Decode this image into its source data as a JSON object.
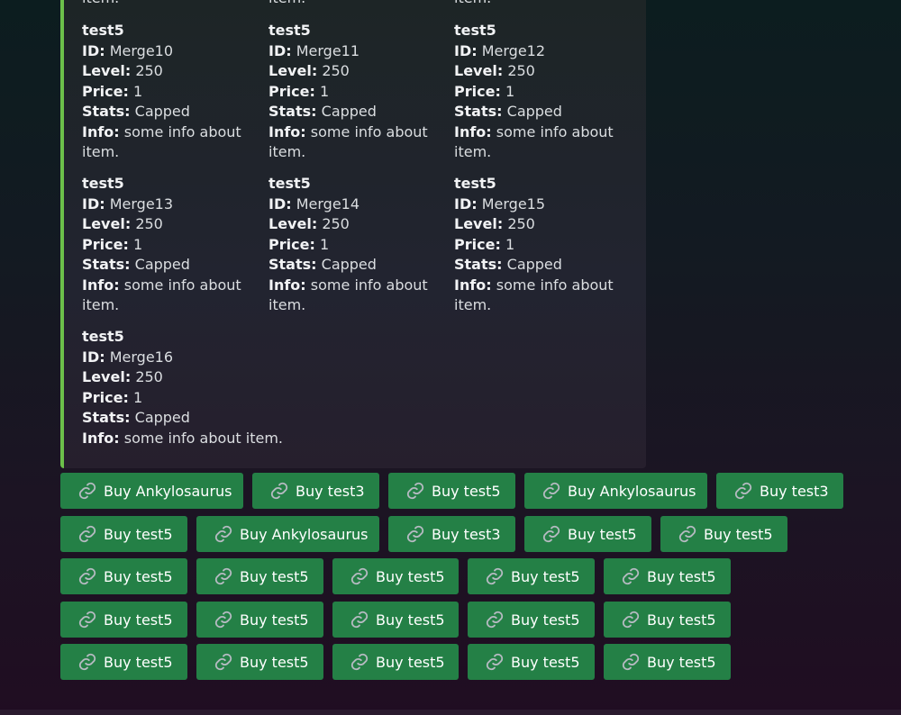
{
  "embed": {
    "accent_color": "#6cc04a",
    "top_partial": [
      "item.",
      "item.",
      "item."
    ],
    "labels": {
      "id": "ID:",
      "level": "Level:",
      "price": "Price:",
      "stats": "Stats:",
      "info": "Info:"
    },
    "fields": [
      {
        "name": "test5",
        "id": "Merge10",
        "level": "250",
        "price": "1",
        "stats": "Capped",
        "info": "some info about item."
      },
      {
        "name": "test5",
        "id": "Merge11",
        "level": "250",
        "price": "1",
        "stats": "Capped",
        "info": "some info about item."
      },
      {
        "name": "test5",
        "id": "Merge12",
        "level": "250",
        "price": "1",
        "stats": "Capped",
        "info": "some info about item."
      },
      {
        "name": "test5",
        "id": "Merge13",
        "level": "250",
        "price": "1",
        "stats": "Capped",
        "info": "some info about item."
      },
      {
        "name": "test5",
        "id": "Merge14",
        "level": "250",
        "price": "1",
        "stats": "Capped",
        "info": "some info about item."
      },
      {
        "name": "test5",
        "id": "Merge15",
        "level": "250",
        "price": "1",
        "stats": "Capped",
        "info": "some info about item."
      },
      {
        "name": "test5",
        "id": "Merge16",
        "level": "250",
        "price": "1",
        "stats": "Capped",
        "info": "some info about item."
      }
    ]
  },
  "buttons": {
    "color": "#248046",
    "icon": "link-icon",
    "rows": [
      [
        "Buy Ankylosaurus",
        "Buy test3",
        "Buy test5",
        "Buy Ankylosaurus",
        "Buy test3"
      ],
      [
        "Buy test5",
        "Buy Ankylosaurus",
        "Buy test3",
        "Buy test5",
        "Buy test5"
      ],
      [
        "Buy test5",
        "Buy test5",
        "Buy test5",
        "Buy test5",
        "Buy test5"
      ],
      [
        "Buy test5",
        "Buy test5",
        "Buy test5",
        "Buy test5",
        "Buy test5"
      ],
      [
        "Buy test5",
        "Buy test5",
        "Buy test5",
        "Buy test5",
        "Buy test5"
      ]
    ]
  }
}
